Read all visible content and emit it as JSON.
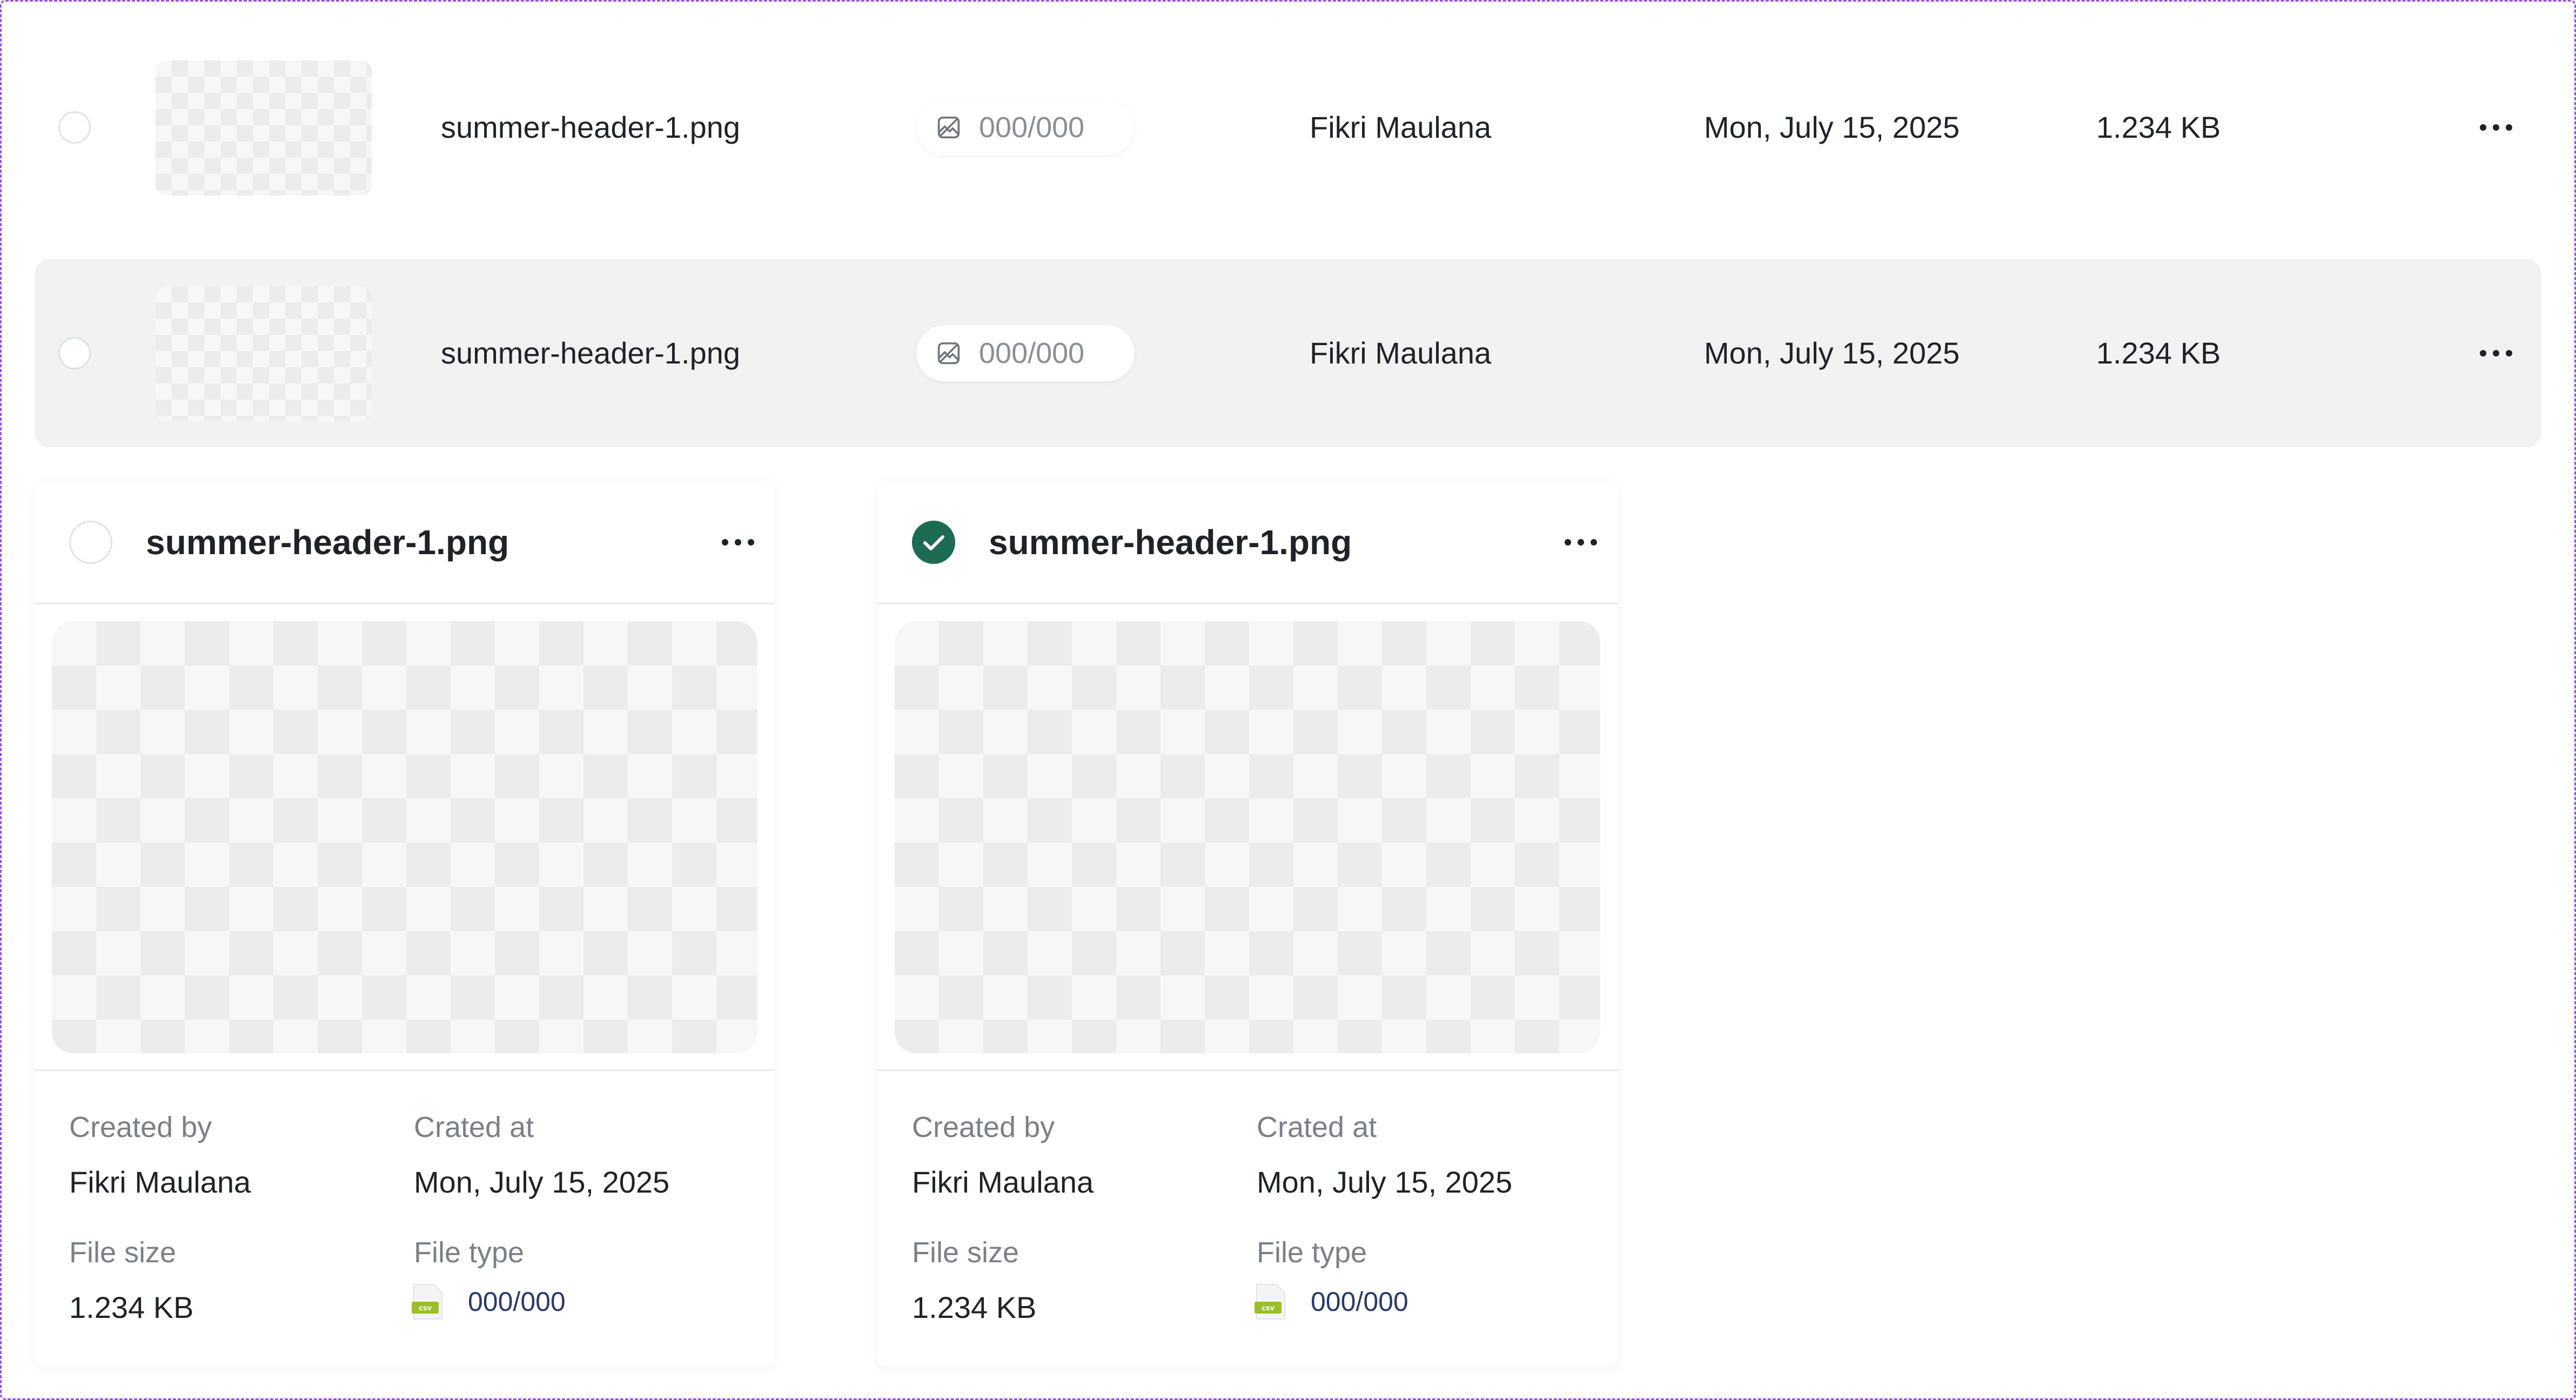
{
  "rows": [
    {
      "filename": "summer-header-1.png",
      "dimensions": "000/000",
      "created_by": "Fikri Maulana",
      "created_at": "Mon, July 15, 2025",
      "file_size": "1.234 KB"
    },
    {
      "filename": "summer-header-1.png",
      "dimensions": "000/000",
      "created_by": "Fikri Maulana",
      "created_at": "Mon, July 15, 2025",
      "file_size": "1.234 KB"
    }
  ],
  "cards": [
    {
      "filename": "summer-header-1.png",
      "selected": false,
      "labels": {
        "created_by": "Created by",
        "created_at": "Crated at",
        "file_size": "File size",
        "file_type": "File type"
      },
      "created_by": "Fikri Maulana",
      "created_at": "Mon, July 15, 2025",
      "file_size": "1.234 KB",
      "file_type_value": "000/000",
      "file_type_icon_text": "csv"
    },
    {
      "filename": "summer-header-1.png",
      "selected": true,
      "labels": {
        "created_by": "Created by",
        "created_at": "Crated at",
        "file_size": "File size",
        "file_type": "File type"
      },
      "created_by": "Fikri Maulana",
      "created_at": "Mon, July 15, 2025",
      "file_size": "1.234 KB",
      "file_type_value": "000/000",
      "file_type_icon_text": "csv"
    }
  ],
  "colors": {
    "selection_border": "#9b4fe0",
    "checked": "#1e6b54",
    "row_hover": "#f1f3f2",
    "csv_icon": "#9bbf2c"
  }
}
